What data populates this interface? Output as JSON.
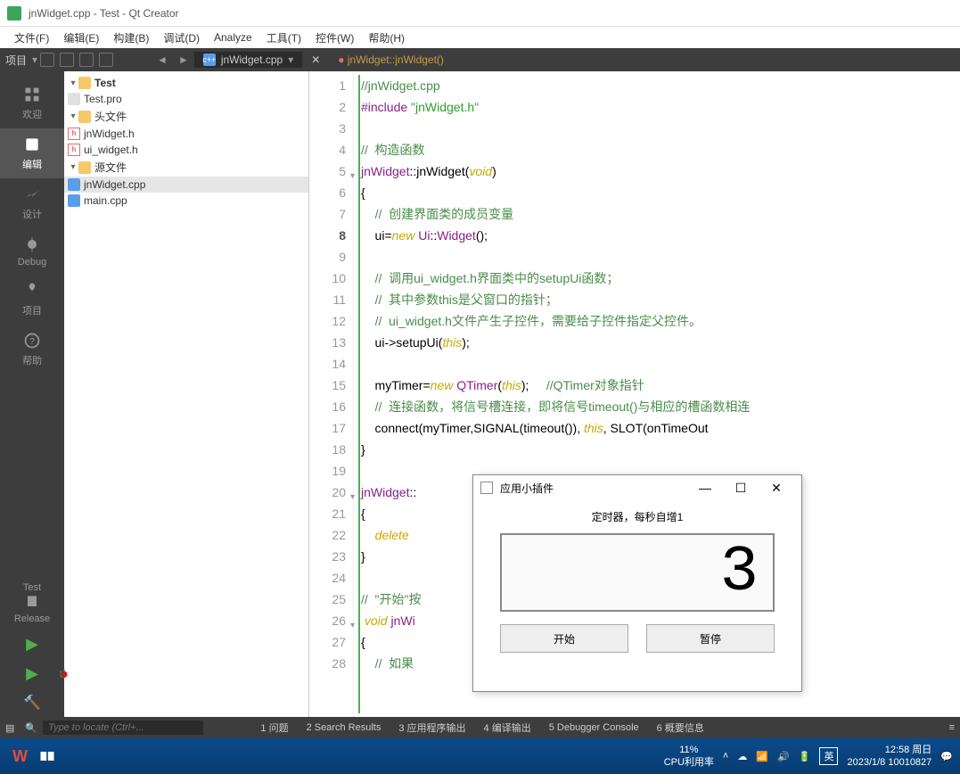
{
  "window": {
    "title": "jnWidget.cpp - Test - Qt Creator"
  },
  "menu": [
    "文件(F)",
    "编辑(E)",
    "构建(B)",
    "调试(D)",
    "Analyze",
    "工具(T)",
    "控件(W)",
    "帮助(H)"
  ],
  "toolbar": {
    "project_label": "项目",
    "open_file": "jnWidget.cpp",
    "symbol": "jnWidget::jnWidget()"
  },
  "sidebar": {
    "items": [
      {
        "label": "欢迎"
      },
      {
        "label": "编辑"
      },
      {
        "label": "设计"
      },
      {
        "label": "Debug"
      },
      {
        "label": "项目"
      },
      {
        "label": "帮助"
      }
    ],
    "target": "Test",
    "config": "Release"
  },
  "tree": {
    "root": "Test",
    "pro": "Test.pro",
    "headers_label": "头文件",
    "headers": [
      "jnWidget.h",
      "ui_widget.h"
    ],
    "sources_label": "源文件",
    "sources": [
      "jnWidget.cpp",
      "main.cpp"
    ]
  },
  "code": {
    "lines": [
      {
        "n": 1,
        "html": "<span class='c-comment'>//jnWidget.cpp</span>"
      },
      {
        "n": 2,
        "html": "<span class='c-prep'>#include</span> <span class='c-str'>\"jnWidget.h\"</span>"
      },
      {
        "n": 3,
        "html": ""
      },
      {
        "n": 4,
        "html": "<span class='c-comment'>//  构造函数</span>"
      },
      {
        "n": 5,
        "html": "<span class='c-type'>jnWidget</span>::<span class='c-func'>jnWidget</span>(<span class='c-kw'>void</span>)",
        "fold": "v"
      },
      {
        "n": 6,
        "html": "{"
      },
      {
        "n": 7,
        "html": "    <span class='c-comment'>//  创建界面类的成员变量</span>"
      },
      {
        "n": 8,
        "html": "    ui=<span class='c-kw'>new</span> <span class='c-type'>Ui</span>::<span class='c-type'>Widget</span>();",
        "current": true
      },
      {
        "n": 9,
        "html": ""
      },
      {
        "n": 10,
        "html": "    <span class='c-comment'>//  调用ui_widget.h界面类中的setupUi函数；</span>"
      },
      {
        "n": 11,
        "html": "    <span class='c-comment'>//  其中参数this是父窗口的指针；</span>"
      },
      {
        "n": 12,
        "html": "    <span class='c-comment'>//  ui_widget.h文件产生子控件，需要给子控件指定父控件。</span>"
      },
      {
        "n": 13,
        "html": "    ui-&gt;setupUi(<span class='c-kw'>this</span>);"
      },
      {
        "n": 14,
        "html": ""
      },
      {
        "n": 15,
        "html": "    myTimer=<span class='c-kw'>new</span> <span class='c-type'>QTimer</span>(<span class='c-kw'>this</span>);     <span class='c-comment'>//QTimer对象指针</span>"
      },
      {
        "n": 16,
        "html": "    <span class='c-comment'>//  连接函数，将信号槽连接，即将信号timeout()与相应的槽函数相连</span>"
      },
      {
        "n": 17,
        "html": "    connect(myTimer,SIGNAL(timeout()), <span class='c-kw'>this</span>, SLOT(onTimeOut"
      },
      {
        "n": 18,
        "html": "}"
      },
      {
        "n": 19,
        "html": ""
      },
      {
        "n": 20,
        "html": "<span class='c-type'>jnWidget</span>::",
        "fold": "v"
      },
      {
        "n": 21,
        "html": "{"
      },
      {
        "n": 22,
        "html": "    <span class='c-kw'>delete</span>"
      },
      {
        "n": 23,
        "html": "}"
      },
      {
        "n": 24,
        "html": ""
      },
      {
        "n": 25,
        "html": "<span class='c-comment'>//  \"开始\"按</span>"
      },
      {
        "n": 26,
        "html": " <span class='c-kw'>void</span> <span class='c-type'>jnWi</span>",
        "fold": "v"
      },
      {
        "n": 27,
        "html": "{"
      },
      {
        "n": 28,
        "html": "    <span class='c-comment'>//  如果</span>                                              <span class='c-comment'>0毫秒，</span>"
      }
    ]
  },
  "statusbar": {
    "locate_placeholder": "Type to locate (Ctrl+...",
    "panels": [
      "1 问题",
      "2 Search Results",
      "3 应用程序输出",
      "4 编译输出",
      "5 Debugger Console",
      "6 概要信息"
    ]
  },
  "popup": {
    "title": "应用小插件",
    "label": "定时器，每秒自增1",
    "value": "3",
    "start": "开始",
    "pause": "暂停"
  },
  "taskbar": {
    "cpu_pct": "11%",
    "cpu_label": "CPU利用率",
    "ime": "英",
    "time": "12:58 周日",
    "date": "2023/1/8  10010827"
  }
}
